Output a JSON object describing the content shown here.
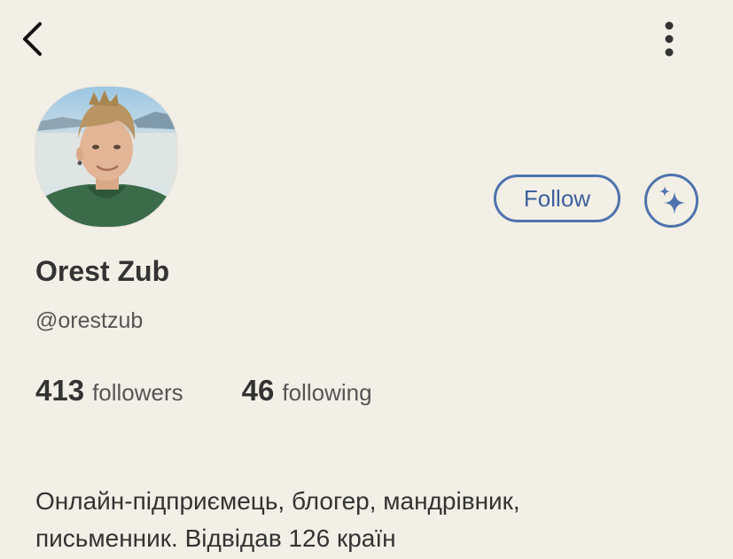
{
  "header": {
    "back_icon": "chevron-left-icon",
    "more_icon": "vertical-ellipsis-icon"
  },
  "profile": {
    "avatar_description": "profile photo",
    "name": "Orest Zub",
    "username": "@orestzub",
    "follow_label": "Follow",
    "sparkle_icon": "sparkle-icon",
    "followers_count": "413",
    "followers_label": "followers",
    "following_count": "46",
    "following_label": "following",
    "bio": "Онлайн-підприємець, блогер, мандрівник, письменник. Відвідав 126 країн"
  },
  "colors": {
    "background": "#f2efe6",
    "accent": "#5073ad",
    "text": "#333333"
  }
}
